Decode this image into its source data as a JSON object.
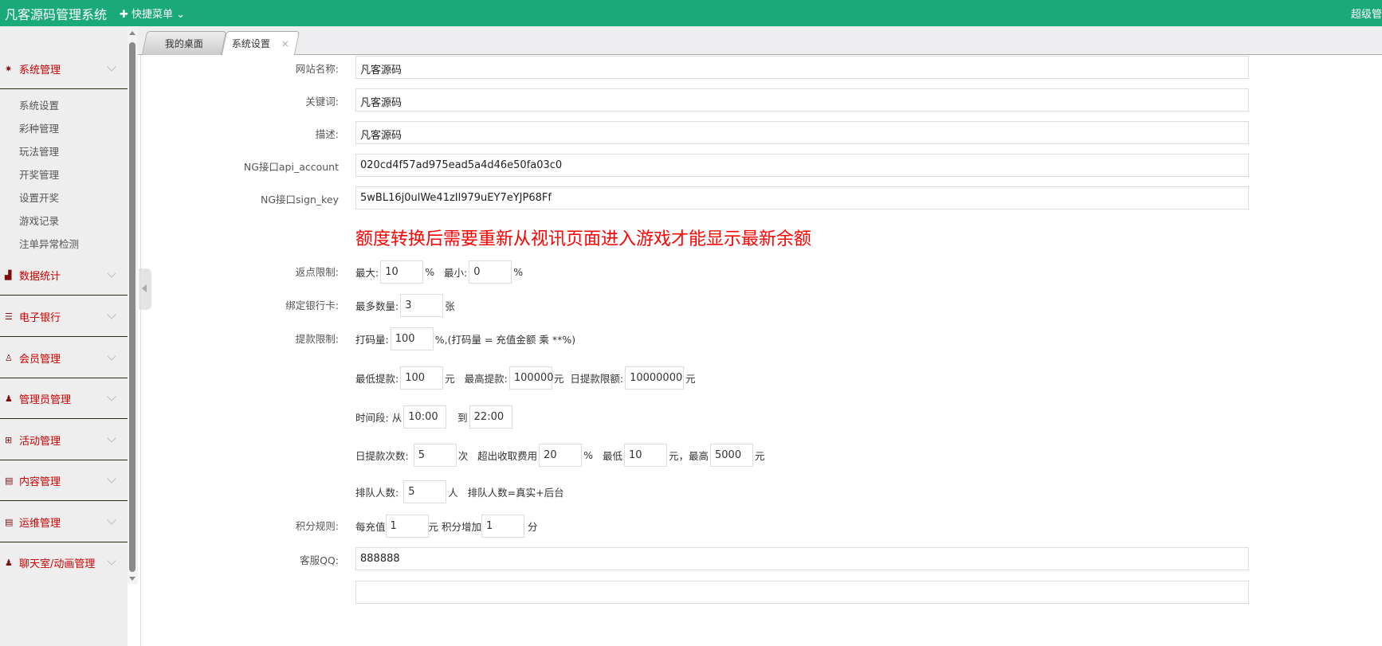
{
  "header": {
    "title": "凡客源码管理系统",
    "quick_menu": "快捷菜单",
    "user": "超级管"
  },
  "sidebar": {
    "groups": [
      {
        "label": "系统管理",
        "icon": "gear-icon",
        "subitems": [
          "系统设置",
          "彩种管理",
          "玩法管理",
          "开奖管理",
          "设置开奖",
          "游戏记录",
          "注单异常检测"
        ]
      },
      {
        "label": "数据统计",
        "icon": "chart-icon"
      },
      {
        "label": "电子银行",
        "icon": "list-icon"
      },
      {
        "label": "会员管理",
        "icon": "user-outline-icon"
      },
      {
        "label": "管理员管理",
        "icon": "user-icon"
      },
      {
        "label": "活动管理",
        "icon": "gift-icon"
      },
      {
        "label": "内容管理",
        "icon": "document-icon"
      },
      {
        "label": "运维管理",
        "icon": "document-icon"
      },
      {
        "label": "聊天室/动画管理",
        "icon": "user-icon"
      }
    ]
  },
  "tabs": [
    {
      "label": "我的桌面"
    },
    {
      "label": "系统设置",
      "close": "×"
    }
  ],
  "form": {
    "site_name": {
      "label": "网站名称:",
      "value": "凡客源码"
    },
    "keywords": {
      "label": "关键词:",
      "value": "凡客源码"
    },
    "description": {
      "label": "描述:",
      "value": "凡客源码"
    },
    "api_account": {
      "label": "NG接口api_account",
      "value": "020cd4f57ad975ead5a4d46e50fa03c0"
    },
    "sign_key": {
      "label": "NG接口sign_key",
      "value": "5wBL16j0ulWe41zIl979uEY7eYJP68Ff"
    },
    "warning": "额度转换后需要重新从视讯页面进入游戏才能显示最新余额",
    "rebate": {
      "label": "返点限制:",
      "max_label": "最大:",
      "max": "10",
      "pct": "%",
      "min_label": "最小:",
      "min": "0",
      "pct2": "%"
    },
    "bank": {
      "label": "绑定银行卡:",
      "max_label": "最多数量:",
      "max": "3",
      "unit": "张"
    },
    "withdraw": {
      "label": "提款限制:",
      "bet_label": "打码量:",
      "bet": "100",
      "bet_note": "%,(打码量 = 充值金额 乘 **%)",
      "min_label": "最低提款:",
      "min": "100",
      "yuan": "元",
      "max_label": "最高提款:",
      "max": "100000",
      "daily_label": "日提款限额:",
      "daily": "10000000",
      "time_label": "时间段:",
      "from": "从",
      "start": "10:00",
      "to": "到",
      "end": "22:00",
      "times_label": "日提款次数:",
      "times": "5",
      "times_unit": "次",
      "fee_label": "超出收取费用",
      "fee": "20",
      "fee_pct": "%",
      "fee_min_label": "最低",
      "fee_min": "10",
      "fee_max_label": "元，最高",
      "fee_max": "5000",
      "queue_label": "排队人数:",
      "queue": "5",
      "queue_unit": "人",
      "queue_note": "排队人数=真实+后台"
    },
    "points": {
      "label": "积分规则:",
      "per": "每充值",
      "amount": "1",
      "yuan": "元",
      "add": "积分增加",
      "pts": "1",
      "unit": "分"
    },
    "qq": {
      "label": "客服QQ:",
      "value": "888888"
    }
  },
  "colors": {
    "header": "#1aaa7a",
    "menu": "#cc0000",
    "warning": "#ff0000"
  }
}
